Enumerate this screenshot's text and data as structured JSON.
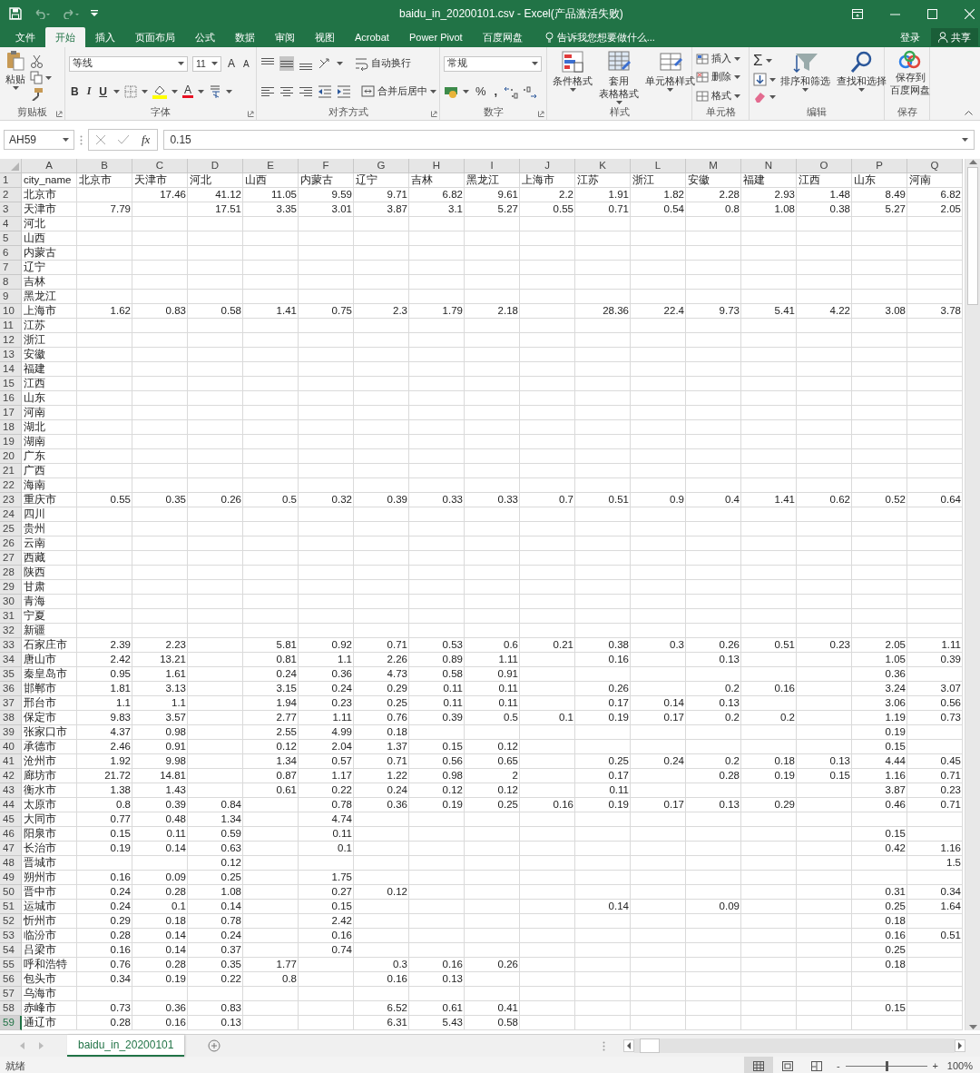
{
  "window": {
    "title": "baidu_in_20200101.csv - Excel(产品激活失败)"
  },
  "ribbon_tabs": [
    {
      "label": "文件",
      "selected": false
    },
    {
      "label": "开始",
      "selected": true
    },
    {
      "label": "插入",
      "selected": false
    },
    {
      "label": "页面布局",
      "selected": false
    },
    {
      "label": "公式",
      "selected": false
    },
    {
      "label": "数据",
      "selected": false
    },
    {
      "label": "审阅",
      "selected": false
    },
    {
      "label": "视图",
      "selected": false
    },
    {
      "label": "Acrobat",
      "selected": false
    },
    {
      "label": "Power Pivot",
      "selected": false
    },
    {
      "label": "百度网盘",
      "selected": false
    }
  ],
  "tell_me": {
    "placeholder": "告诉我您想要做什么..."
  },
  "account": {
    "sign_in": "登录",
    "share": "共享"
  },
  "ribbon_groups": [
    {
      "kind": "clipboard",
      "label": "剪贴板",
      "paste": "粘贴"
    },
    {
      "kind": "font",
      "label": "字体",
      "font": "等线",
      "size": "11",
      "grow": "A",
      "shrink": "A",
      "styles": [
        "B",
        "I",
        "U"
      ],
      "font_color": "A"
    },
    {
      "kind": "alignment",
      "label": "对齐方式",
      "wrap": "自动换行",
      "merge": "合并后居中"
    },
    {
      "kind": "number",
      "label": "数字",
      "format": "常规",
      "percent": "%",
      "comma": ","
    },
    {
      "kind": "styles",
      "label": "样式",
      "buttons": [
        {
          "lines": [
            "条件格式"
          ]
        },
        {
          "lines": [
            "套用",
            "表格格式"
          ]
        },
        {
          "lines": [
            "单元格样式"
          ]
        }
      ]
    },
    {
      "kind": "cells",
      "label": "单元格",
      "buttons": [
        "插入",
        "删除",
        "格式"
      ]
    },
    {
      "kind": "editing",
      "label": "编辑",
      "sum": "Σ",
      "buttons": [
        "排序和筛选",
        "查找和选择"
      ]
    },
    {
      "kind": "save",
      "label": "保存",
      "button_lines": [
        "保存到",
        "百度网盘"
      ]
    }
  ],
  "formula_bar": {
    "name_box": "AH59",
    "fx": "fx",
    "value": "0.15"
  },
  "grid": {
    "columns": [
      "A",
      "B",
      "C",
      "D",
      "E",
      "F",
      "G",
      "H",
      "I",
      "J",
      "K",
      "L",
      "M",
      "N",
      "O",
      "P",
      "Q"
    ],
    "rows": [
      {
        "n": "1",
        "selected": false,
        "cells": [
          "city_name",
          "北京市",
          "天津市",
          "河北",
          "山西",
          "内蒙古",
          "辽宁",
          "吉林",
          "黑龙江",
          "上海市",
          "江苏",
          "浙江",
          "安徽",
          "福建",
          "江西",
          "山东",
          "河南"
        ]
      },
      {
        "n": "2",
        "selected": false,
        "cells": [
          "北京市",
          null,
          "17.46",
          "41.12",
          "11.05",
          "9.59",
          "9.71",
          "6.82",
          "9.61",
          "2.2",
          "1.91",
          "1.82",
          "2.28",
          "2.93",
          "1.48",
          "8.49",
          "6.82"
        ]
      },
      {
        "n": "3",
        "selected": false,
        "cells": [
          "天津市",
          "7.79",
          null,
          "17.51",
          "3.35",
          "3.01",
          "3.87",
          "3.1",
          "5.27",
          "0.55",
          "0.71",
          "0.54",
          "0.8",
          "1.08",
          "0.38",
          "5.27",
          "2.05"
        ]
      },
      {
        "n": "4",
        "selected": false,
        "cells": [
          "河北"
        ]
      },
      {
        "n": "5",
        "selected": false,
        "cells": [
          "山西"
        ]
      },
      {
        "n": "6",
        "selected": false,
        "cells": [
          "内蒙古"
        ]
      },
      {
        "n": "7",
        "selected": false,
        "cells": [
          "辽宁"
        ]
      },
      {
        "n": "8",
        "selected": false,
        "cells": [
          "吉林"
        ]
      },
      {
        "n": "9",
        "selected": false,
        "cells": [
          "黑龙江"
        ]
      },
      {
        "n": "10",
        "selected": false,
        "cells": [
          "上海市",
          "1.62",
          "0.83",
          "0.58",
          "1.41",
          "0.75",
          "2.3",
          "1.79",
          "2.18",
          null,
          "28.36",
          "22.4",
          "9.73",
          "5.41",
          "4.22",
          "3.08",
          "3.78"
        ]
      },
      {
        "n": "11",
        "selected": false,
        "cells": [
          "江苏"
        ]
      },
      {
        "n": "12",
        "selected": false,
        "cells": [
          "浙江"
        ]
      },
      {
        "n": "13",
        "selected": false,
        "cells": [
          "安徽"
        ]
      },
      {
        "n": "14",
        "selected": false,
        "cells": [
          "福建"
        ]
      },
      {
        "n": "15",
        "selected": false,
        "cells": [
          "江西"
        ]
      },
      {
        "n": "16",
        "selected": false,
        "cells": [
          "山东"
        ]
      },
      {
        "n": "17",
        "selected": false,
        "cells": [
          "河南"
        ]
      },
      {
        "n": "18",
        "selected": false,
        "cells": [
          "湖北"
        ]
      },
      {
        "n": "19",
        "selected": false,
        "cells": [
          "湖南"
        ]
      },
      {
        "n": "20",
        "selected": false,
        "cells": [
          "广东"
        ]
      },
      {
        "n": "21",
        "selected": false,
        "cells": [
          "广西"
        ]
      },
      {
        "n": "22",
        "selected": false,
        "cells": [
          "海南"
        ]
      },
      {
        "n": "23",
        "selected": false,
        "cells": [
          "重庆市",
          "0.55",
          "0.35",
          "0.26",
          "0.5",
          "0.32",
          "0.39",
          "0.33",
          "0.33",
          "0.7",
          "0.51",
          "0.9",
          "0.4",
          "1.41",
          "0.62",
          "0.52",
          "0.64"
        ]
      },
      {
        "n": "24",
        "selected": false,
        "cells": [
          "四川"
        ]
      },
      {
        "n": "25",
        "selected": false,
        "cells": [
          "贵州"
        ]
      },
      {
        "n": "26",
        "selected": false,
        "cells": [
          "云南"
        ]
      },
      {
        "n": "27",
        "selected": false,
        "cells": [
          "西藏"
        ]
      },
      {
        "n": "28",
        "selected": false,
        "cells": [
          "陕西"
        ]
      },
      {
        "n": "29",
        "selected": false,
        "cells": [
          "甘肃"
        ]
      },
      {
        "n": "30",
        "selected": false,
        "cells": [
          "青海"
        ]
      },
      {
        "n": "31",
        "selected": false,
        "cells": [
          "宁夏"
        ]
      },
      {
        "n": "32",
        "selected": false,
        "cells": [
          "新疆"
        ]
      },
      {
        "n": "33",
        "selected": false,
        "cells": [
          "石家庄市",
          "2.39",
          "2.23",
          null,
          "5.81",
          "0.92",
          "0.71",
          "0.53",
          "0.6",
          "0.21",
          "0.38",
          "0.3",
          "0.26",
          "0.51",
          "0.23",
          "2.05",
          "1.11"
        ]
      },
      {
        "n": "34",
        "selected": false,
        "cells": [
          "唐山市",
          "2.42",
          "13.21",
          null,
          "0.81",
          "1.1",
          "2.26",
          "0.89",
          "1.11",
          null,
          "0.16",
          null,
          "0.13",
          null,
          null,
          "1.05",
          "0.39"
        ]
      },
      {
        "n": "35",
        "selected": false,
        "cells": [
          "秦皇岛市",
          "0.95",
          "1.61",
          null,
          "0.24",
          "0.36",
          "4.73",
          "0.58",
          "0.91",
          null,
          null,
          null,
          null,
          null,
          null,
          "0.36",
          null
        ]
      },
      {
        "n": "36",
        "selected": false,
        "cells": [
          "邯郸市",
          "1.81",
          "3.13",
          null,
          "3.15",
          "0.24",
          "0.29",
          "0.11",
          "0.11",
          null,
          "0.26",
          null,
          "0.2",
          "0.16",
          null,
          "3.24",
          "3.07"
        ]
      },
      {
        "n": "37",
        "selected": false,
        "cells": [
          "邢台市",
          "1.1",
          "1.1",
          null,
          "1.94",
          "0.23",
          "0.25",
          "0.11",
          "0.11",
          null,
          "0.17",
          "0.14",
          "0.13",
          null,
          null,
          "3.06",
          "0.56"
        ]
      },
      {
        "n": "38",
        "selected": false,
        "cells": [
          "保定市",
          "9.83",
          "3.57",
          null,
          "2.77",
          "1.11",
          "0.76",
          "0.39",
          "0.5",
          "0.1",
          "0.19",
          "0.17",
          "0.2",
          "0.2",
          null,
          "1.19",
          "0.73"
        ]
      },
      {
        "n": "39",
        "selected": false,
        "cells": [
          "张家口市",
          "4.37",
          "0.98",
          null,
          "2.55",
          "4.99",
          "0.18",
          null,
          null,
          null,
          null,
          null,
          null,
          null,
          null,
          "0.19",
          null
        ]
      },
      {
        "n": "40",
        "selected": false,
        "cells": [
          "承德市",
          "2.46",
          "0.91",
          null,
          "0.12",
          "2.04",
          "1.37",
          "0.15",
          "0.12",
          null,
          null,
          null,
          null,
          null,
          null,
          "0.15",
          null
        ]
      },
      {
        "n": "41",
        "selected": false,
        "cells": [
          "沧州市",
          "1.92",
          "9.98",
          null,
          "1.34",
          "0.57",
          "0.71",
          "0.56",
          "0.65",
          null,
          "0.25",
          "0.24",
          "0.2",
          "0.18",
          "0.13",
          "4.44",
          "0.45"
        ]
      },
      {
        "n": "42",
        "selected": false,
        "cells": [
          "廊坊市",
          "21.72",
          "14.81",
          null,
          "0.87",
          "1.17",
          "1.22",
          "0.98",
          "2",
          null,
          "0.17",
          null,
          "0.28",
          "0.19",
          "0.15",
          "1.16",
          "0.71"
        ]
      },
      {
        "n": "43",
        "selected": false,
        "cells": [
          "衡水市",
          "1.38",
          "1.43",
          null,
          "0.61",
          "0.22",
          "0.24",
          "0.12",
          "0.12",
          null,
          "0.11",
          null,
          null,
          null,
          null,
          "3.87",
          "0.23"
        ]
      },
      {
        "n": "44",
        "selected": false,
        "cells": [
          "太原市",
          "0.8",
          "0.39",
          "0.84",
          null,
          "0.78",
          "0.36",
          "0.19",
          "0.25",
          "0.16",
          "0.19",
          "0.17",
          "0.13",
          "0.29",
          null,
          "0.46",
          "0.71"
        ]
      },
      {
        "n": "45",
        "selected": false,
        "cells": [
          "大同市",
          "0.77",
          "0.48",
          "1.34",
          null,
          "4.74"
        ]
      },
      {
        "n": "46",
        "selected": false,
        "cells": [
          "阳泉市",
          "0.15",
          "0.11",
          "0.59",
          null,
          "0.11",
          null,
          null,
          null,
          null,
          null,
          null,
          null,
          null,
          null,
          "0.15",
          null
        ]
      },
      {
        "n": "47",
        "selected": false,
        "cells": [
          "长治市",
          "0.19",
          "0.14",
          "0.63",
          null,
          "0.1",
          null,
          null,
          null,
          null,
          null,
          null,
          null,
          null,
          null,
          "0.42",
          "1.16"
        ]
      },
      {
        "n": "48",
        "selected": false,
        "cells": [
          "晋城市",
          null,
          null,
          "0.12",
          null,
          null,
          null,
          null,
          null,
          null,
          null,
          null,
          null,
          null,
          null,
          null,
          "1.5"
        ]
      },
      {
        "n": "49",
        "selected": false,
        "cells": [
          "朔州市",
          "0.16",
          "0.09",
          "0.25",
          null,
          "1.75"
        ]
      },
      {
        "n": "50",
        "selected": false,
        "cells": [
          "晋中市",
          "0.24",
          "0.28",
          "1.08",
          null,
          "0.27",
          "0.12",
          null,
          null,
          null,
          null,
          null,
          null,
          null,
          null,
          "0.31",
          "0.34"
        ]
      },
      {
        "n": "51",
        "selected": false,
        "cells": [
          "运城市",
          "0.24",
          "0.1",
          "0.14",
          null,
          "0.15",
          null,
          null,
          null,
          null,
          "0.14",
          null,
          "0.09",
          null,
          null,
          "0.25",
          "1.64"
        ]
      },
      {
        "n": "52",
        "selected": false,
        "cells": [
          "忻州市",
          "0.29",
          "0.18",
          "0.78",
          null,
          "2.42",
          null,
          null,
          null,
          null,
          null,
          null,
          null,
          null,
          null,
          "0.18",
          null
        ]
      },
      {
        "n": "53",
        "selected": false,
        "cells": [
          "临汾市",
          "0.28",
          "0.14",
          "0.24",
          null,
          "0.16",
          null,
          null,
          null,
          null,
          null,
          null,
          null,
          null,
          null,
          "0.16",
          "0.51"
        ]
      },
      {
        "n": "54",
        "selected": false,
        "cells": [
          "吕梁市",
          "0.16",
          "0.14",
          "0.37",
          null,
          "0.74",
          null,
          null,
          null,
          null,
          null,
          null,
          null,
          null,
          null,
          "0.25",
          null
        ]
      },
      {
        "n": "55",
        "selected": false,
        "cells": [
          "呼和浩特",
          "0.76",
          "0.28",
          "0.35",
          "1.77",
          null,
          "0.3",
          "0.16",
          "0.26",
          null,
          null,
          null,
          null,
          null,
          null,
          "0.18",
          null
        ]
      },
      {
        "n": "56",
        "selected": false,
        "cells": [
          "包头市",
          "0.34",
          "0.19",
          "0.22",
          "0.8",
          null,
          "0.16",
          "0.13"
        ]
      },
      {
        "n": "57",
        "selected": false,
        "cells": [
          "乌海市"
        ]
      },
      {
        "n": "58",
        "selected": false,
        "cells": [
          "赤峰市",
          "0.73",
          "0.36",
          "0.83",
          null,
          null,
          "6.52",
          "0.61",
          "0.41",
          null,
          null,
          null,
          null,
          null,
          null,
          "0.15",
          null
        ]
      },
      {
        "n": "59",
        "selected": true,
        "cells": [
          "通辽市",
          "0.28",
          "0.16",
          "0.13",
          null,
          null,
          "6.31",
          "5.43",
          "0.58"
        ]
      }
    ]
  },
  "sheet_tabs": [
    {
      "label": "baidu_in_20200101",
      "selected": true
    }
  ],
  "status_bar": {
    "text": "就绪",
    "zoom_out": "-",
    "zoom_in": "+",
    "zoom": "100%",
    "zoom_slider": {
      "level": 0.5
    }
  }
}
